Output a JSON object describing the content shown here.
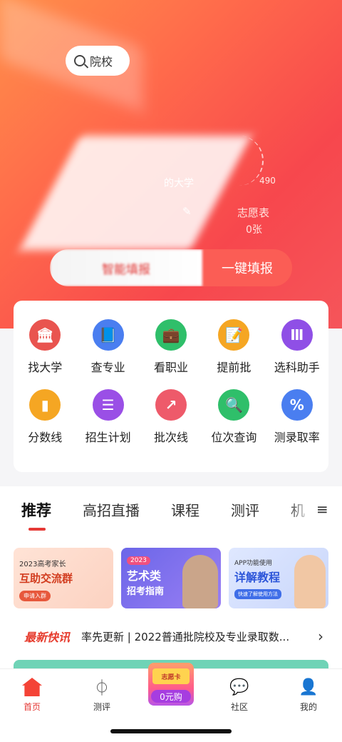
{
  "search": {
    "placeholder": "院校"
  },
  "profile": {
    "partial_name": "的大学",
    "score_hint": "490",
    "zhiyuan_label": "志愿表",
    "zhiyuan_count": "0张"
  },
  "actions": {
    "smart_fill": "智能填报",
    "one_click_fill": "一键填报"
  },
  "tools": [
    {
      "label": "找大学",
      "icon": "university-icon",
      "color": "#e9544f",
      "glyph": "🏛"
    },
    {
      "label": "查专业",
      "icon": "book-icon",
      "color": "#4a7ef0",
      "glyph": "📘"
    },
    {
      "label": "看职业",
      "icon": "briefcase-icon",
      "color": "#2fbf6a",
      "glyph": "💼"
    },
    {
      "label": "提前批",
      "icon": "document-edit-icon",
      "color": "#f5a623",
      "glyph": "📝"
    },
    {
      "label": "选科助手",
      "icon": "books-icon",
      "color": "#8f4fe6",
      "glyph": "Ⅲ"
    },
    {
      "label": "分数线",
      "icon": "bar-chart-icon",
      "color": "#f5a623",
      "glyph": "▮"
    },
    {
      "label": "招生计划",
      "icon": "plan-icon",
      "color": "#9a4fe6",
      "glyph": "☰"
    },
    {
      "label": "批次线",
      "icon": "trend-chart-icon",
      "color": "#ee5a6a",
      "glyph": "↗"
    },
    {
      "label": "位次查询",
      "icon": "clipboard-search-icon",
      "color": "#2fbf6a",
      "glyph": "🔍"
    },
    {
      "label": "测录取率",
      "icon": "percent-icon",
      "color": "#4a7ef0",
      "glyph": "%"
    }
  ],
  "tabs": [
    "推荐",
    "高招直播",
    "课程",
    "测评",
    "机"
  ],
  "banners": {
    "b1": {
      "small": "2023高考家长",
      "big": "互助交流群",
      "btn": "申请入群"
    },
    "b2": {
      "year": "2023",
      "title": "艺术类",
      "sub": "招考指南"
    },
    "b3": {
      "small": "APP功能使用",
      "big": "详解教程",
      "btn": "快速了解使用方法"
    }
  },
  "news": {
    "tag": "最新快讯",
    "text": "率先更新 | 2022普通批院校及专业录取数..."
  },
  "nav": {
    "home": "首页",
    "test": "测评",
    "promo_card": "志愿卡",
    "promo_label": "0元购",
    "community": "社区",
    "mine": "我的"
  }
}
